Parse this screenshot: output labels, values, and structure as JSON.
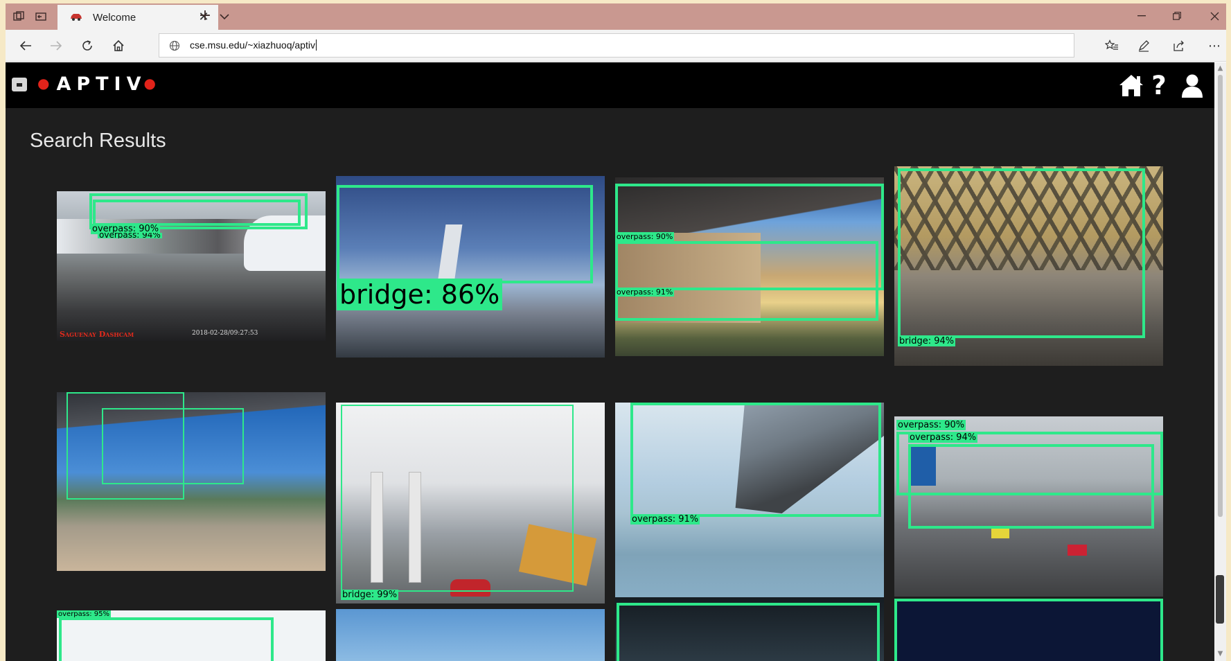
{
  "browser": {
    "tab": {
      "title": "Welcome",
      "close_glyph": "✕"
    },
    "new_tab_glyph": "+",
    "tab_list_glyph": "⌵",
    "address": "cse.msu.edu/~xiazhuoq/aptiv",
    "window_controls": {
      "minimize": "—",
      "restore": "❐",
      "close": "✕"
    },
    "more_glyph": "⋯"
  },
  "site": {
    "logo_text": "APTIV",
    "logo_accent_color": "#e2231a",
    "header_icons": [
      "home-icon",
      "help-icon",
      "user-icon"
    ],
    "help_glyph": "?"
  },
  "page_title": "Search Results",
  "detections": {
    "r1c1": [
      "overpass: 90%",
      "overpass: 94%"
    ],
    "r1c1_watermark": "Saguenay Dashcam",
    "r1c1_timestamp": "2018-02-28/09:27:53",
    "r1c2": [
      "bridge: 86%"
    ],
    "r1c3": [
      "overpass: 90%",
      "overpass: 91%"
    ],
    "r1c4": [
      "bridge: 94%"
    ],
    "r2c2": [
      "bridge: 99%"
    ],
    "r2c3": [
      "overpass: 91%"
    ],
    "r2c4": [
      "overpass: 90%",
      "overpass: 94%"
    ],
    "r3c1": [
      "overpass: 95%"
    ]
  },
  "box_color": "#2ee88a"
}
